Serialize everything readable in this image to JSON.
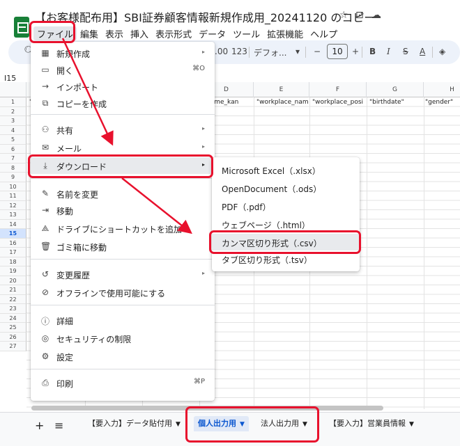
{
  "header": {
    "doc_title": "【お客様配布用】SBI証券顧客情報新規作成用_20241120 のコピー",
    "star_icon": "star-icon",
    "move_icon": "folder-move-icon",
    "cloud_icon": "cloud-status-icon"
  },
  "menubar": [
    "ファイル",
    "編集",
    "表示",
    "挿入",
    "表示形式",
    "データ",
    "ツール",
    "拡張機能",
    "ヘルプ"
  ],
  "toolbar": {
    "decimal_more": ".00",
    "number_format": "123",
    "font_family": "デフォ...",
    "font_size": "10",
    "minus": "−",
    "plus": "+",
    "bold": "B",
    "italic": "I",
    "strikethrough": "S",
    "text_color": "A"
  },
  "namebox": "I15",
  "grid": {
    "columns": [
      "D",
      "E",
      "F",
      "G",
      "H"
    ],
    "row_numbers": [
      "1",
      "2",
      "3",
      "4",
      "5",
      "6",
      "7",
      "8",
      "9",
      "10",
      "11",
      "12",
      "13",
      "14",
      "15",
      "16",
      "17",
      "18",
      "19",
      "20",
      "21",
      "22",
      "23",
      "24",
      "25",
      "26",
      "27"
    ],
    "selected_row": "15",
    "row1_cells": [
      "\"",
      "t_name_kan",
      "\"workplace_nam",
      "\"workplace_posi",
      "\"birthdate\"",
      "\"gender\""
    ]
  },
  "file_menu": {
    "items": [
      {
        "icon": "new-sheet-icon",
        "label": "新規作成",
        "arrow": "▸"
      },
      {
        "icon": "open-folder-icon",
        "label": "開く",
        "shortcut": "⌘O"
      },
      {
        "icon": "import-icon",
        "label": "インポート"
      },
      {
        "icon": "copy-icon",
        "label": "コピーを作成"
      },
      {
        "icon": "share-icon",
        "label": "共有",
        "arrow": "▸"
      },
      {
        "icon": "mail-icon",
        "label": "メール",
        "arrow": "▸"
      },
      {
        "icon": "download-icon",
        "label": "ダウンロード",
        "arrow": "▸"
      },
      {
        "icon": "rename-icon",
        "label": "名前を変更"
      },
      {
        "icon": "move-icon",
        "label": "移動"
      },
      {
        "icon": "drive-shortcut-icon",
        "label": "ドライブにショートカットを追加"
      },
      {
        "icon": "trash-icon",
        "label": "ゴミ箱に移動"
      },
      {
        "icon": "history-icon",
        "label": "変更履歴",
        "arrow": "▸"
      },
      {
        "icon": "offline-icon",
        "label": "オフラインで使用可能にする"
      },
      {
        "icon": "info-icon",
        "label": "詳細"
      },
      {
        "icon": "security-icon",
        "label": "セキュリティの制限"
      },
      {
        "icon": "settings-icon",
        "label": "設定"
      },
      {
        "icon": "print-icon",
        "label": "印刷",
        "shortcut": "⌘P"
      }
    ]
  },
  "download_menu": {
    "items": [
      "Microsoft Excel（.xlsx）",
      "OpenDocument（.ods）",
      "PDF（.pdf）",
      "ウェブページ（.html）",
      "カンマ区切り形式（.csv）",
      "タブ区切り形式（.tsv）"
    ]
  },
  "sheet_tabs": {
    "add": "+",
    "all": "≡",
    "tabs": [
      {
        "label": "【要入力】データ貼付用",
        "active": false
      },
      {
        "label": "個人出力用",
        "active": true
      },
      {
        "label": "法人出力用",
        "active": false
      },
      {
        "label": "【要入力】営業員情報",
        "active": false
      }
    ],
    "caret": "▼"
  },
  "colors": {
    "annotation_red": "#e8112d",
    "sheets_green": "#188038",
    "active_blue": "#0b57d0"
  }
}
